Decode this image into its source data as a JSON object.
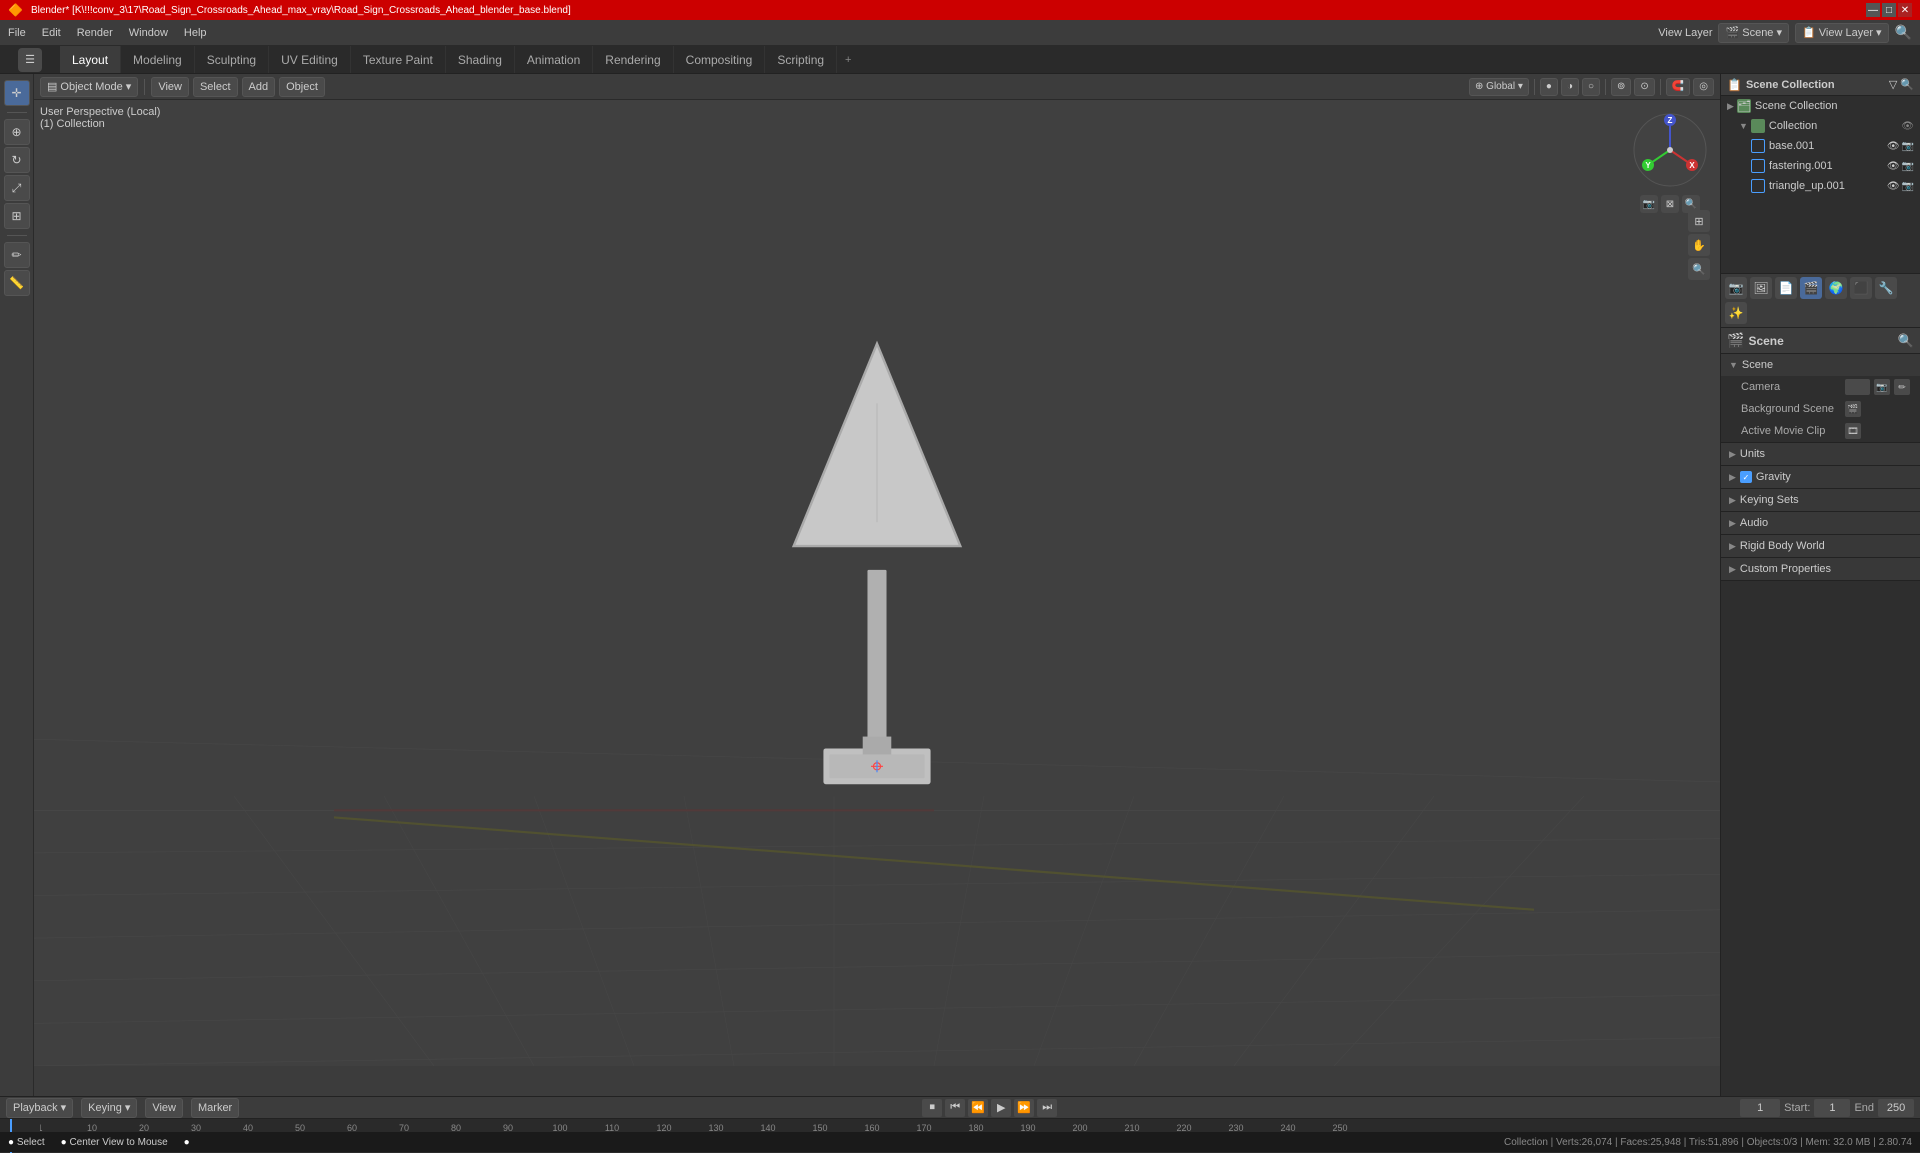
{
  "titlebar": {
    "title": "Blender* [K\\!!!conv_3\\17\\Road_Sign_Crossroads_Ahead_max_vray\\Road_Sign_Crossroads_Ahead_blender_base.blend]",
    "controls": [
      "—",
      "□",
      "✕"
    ]
  },
  "menubar": {
    "items": [
      "File",
      "Edit",
      "Render",
      "Window",
      "Help"
    ]
  },
  "workspace_tabs": {
    "tabs": [
      "Layout",
      "Modeling",
      "Sculpting",
      "UV Editing",
      "Texture Paint",
      "Shading",
      "Animation",
      "Rendering",
      "Compositing",
      "Scripting"
    ],
    "active": "Layout",
    "plus": "+"
  },
  "viewport": {
    "mode": "Object Mode",
    "view_name": "User Perspective (Local)",
    "collection": "(1) Collection",
    "global_label": "Global",
    "info_text": "User Perspective (Local)\n(1) Collection"
  },
  "outliner": {
    "header_title": "Scene Collection",
    "items": [
      {
        "name": "Collection",
        "level": 0,
        "icon": "collection"
      },
      {
        "name": "base.001",
        "level": 1,
        "icon": "mesh"
      },
      {
        "name": "fastering.001",
        "level": 1,
        "icon": "mesh"
      },
      {
        "name": "triangle_up.001",
        "level": 1,
        "icon": "mesh"
      }
    ]
  },
  "properties_panel": {
    "title": "Scene",
    "subtitle": "Scene",
    "sections": [
      {
        "name": "Scene",
        "expanded": true,
        "rows": [
          {
            "label": "Camera",
            "value": "",
            "has_icon": true
          },
          {
            "label": "Background Scene",
            "value": "",
            "has_icon": true
          },
          {
            "label": "Active Movie Clip",
            "value": "",
            "has_icon": true
          }
        ]
      },
      {
        "name": "Units",
        "expanded": false,
        "rows": []
      },
      {
        "name": "Gravity",
        "expanded": false,
        "rows": [],
        "has_checkbox": true,
        "checkbox_active": true
      },
      {
        "name": "Keying Sets",
        "expanded": false,
        "rows": []
      },
      {
        "name": "Audio",
        "expanded": false,
        "rows": []
      },
      {
        "name": "Rigid Body World",
        "expanded": false,
        "rows": []
      },
      {
        "name": "Custom Properties",
        "expanded": false,
        "rows": []
      }
    ]
  },
  "timeline": {
    "playback_label": "Playback",
    "keying_label": "Keying",
    "view_label": "View",
    "marker_label": "Marker",
    "start_label": "Start:",
    "start_value": "1",
    "end_label": "End",
    "end_value": "250",
    "current_frame": "1",
    "frame_markers": [
      "1",
      "10",
      "20",
      "30",
      "40",
      "50",
      "60",
      "70",
      "80",
      "90",
      "100",
      "110",
      "120",
      "130",
      "140",
      "150",
      "160",
      "170",
      "180",
      "190",
      "200",
      "210",
      "220",
      "230",
      "240",
      "250"
    ]
  },
  "statusbar": {
    "left_text": "Select",
    "center_text": "Center View to Mouse",
    "right_text": "Collection | Verts:26,074 | Faces:25,948 | Tris:51,896 | Objects:0/3 | Mem: 32.0 MB | 2.80.74"
  },
  "toolbar": {
    "buttons": [
      "cursor",
      "move",
      "rotate",
      "scale",
      "transform",
      "annotate",
      "measure"
    ]
  },
  "nav_gizmo": {
    "x_label": "X",
    "y_label": "Y",
    "z_label": "Z",
    "x_color": "#cc3333",
    "y_color": "#33cc33",
    "z_color": "#3355cc"
  }
}
